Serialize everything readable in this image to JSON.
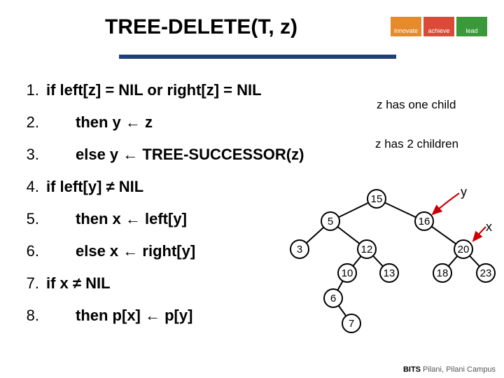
{
  "title": "TREE-DELETE(T, z)",
  "logo": {
    "b1": "innovate",
    "b2": "achieve",
    "b3": "lead"
  },
  "code": {
    "l1": {
      "n": "1.",
      "t": "if left[z] = NIL or right[z] = NIL"
    },
    "l2": {
      "n": "2.",
      "t": "then y ← z"
    },
    "l3": {
      "n": "3.",
      "t": "else y ← TREE-SUCCESSOR(z)"
    },
    "l4": {
      "n": "4.",
      "t": "if left[y] ≠ NIL"
    },
    "l5": {
      "n": "5.",
      "t": "then x ← left[y]"
    },
    "l6": {
      "n": "6.",
      "t": "else x ← right[y]"
    },
    "l7": {
      "n": "7.",
      "t": "if x ≠ NIL"
    },
    "l8": {
      "n": "8.",
      "t": "then p[x] ← p[y]"
    }
  },
  "ann": {
    "one": "z has one child",
    "two": "z has 2 children"
  },
  "tree": {
    "n15": "15",
    "n5": "5",
    "n16": "16",
    "n3": "3",
    "n12": "12",
    "n20": "20",
    "n10": "10",
    "n13": "13",
    "n18": "18",
    "n23": "23",
    "n6": "6",
    "n7": "7",
    "lbl_y": "y",
    "lbl_x": "x"
  },
  "footer": {
    "bold": "BITS",
    "rest": " Pilani, Pilani Campus"
  }
}
